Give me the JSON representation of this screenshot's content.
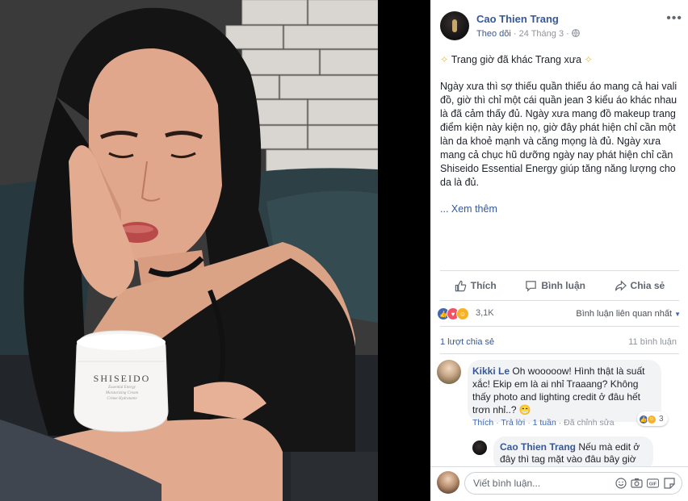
{
  "jar": {
    "brand": "SHISEIDO",
    "line1": "Essential Energy",
    "line2": "Moisturizing Cream",
    "line3": "Crème Hydratante"
  },
  "post": {
    "author": "Cao Thien Trang",
    "follow": "Theo dõi",
    "date": "24 Tháng 3",
    "options_icon": "more-options-icon",
    "headline": "Trang giờ đã khác Trang xưa",
    "body": "Ngày xưa thì sợ thiếu quần thiếu áo mang cả hai vali đồ, giờ thì chỉ một cái quần jean 3 kiểu áo khác nhau là đã cảm thấy đủ. Ngày xưa mang đồ makeup trang điểm kiện này kiện nọ, giờ đây phát hiện chỉ cần một làn da khoẻ mạnh và căng mọng là đủ. Ngày xưa mang cả chục hũ dưỡng ngày nay phát hiện chỉ cần Shiseido Essential Energy giúp tăng năng lượng cho da là đủ.",
    "see_more": "... Xem thêm"
  },
  "actions": {
    "like": "Thích",
    "comment": "Bình luận",
    "share": "Chia sẻ"
  },
  "stats": {
    "reactions": "3,1K",
    "sort_label": "Bình luận liên quan nhất",
    "shares": "1 lượt chia sẻ",
    "comments": "11 bình luận"
  },
  "comment": {
    "author": "Kikki Le",
    "text": " Oh wooooow! Hình thật là suất xắc! Ekip em là ai nhỉ Traaang? Không thấy photo and lighting credit ở đâu hết trơn nhỉ..? ",
    "emoji": "😁",
    "like": "Thích",
    "reply": "Trả lời",
    "time": "1 tuần",
    "edited": "Đã chỉnh sửa",
    "reaction_count": "3"
  },
  "reply": {
    "author": "Cao Thien Trang",
    "text": " Nếu mà edit ở đây thì tag mặt vào đâu bây giờ"
  },
  "composer": {
    "placeholder": "Viết bình luận..."
  },
  "colors": {
    "link": "#365899",
    "accent": "#4267b2",
    "muted": "#90949c",
    "bubble": "#f2f3f5"
  }
}
